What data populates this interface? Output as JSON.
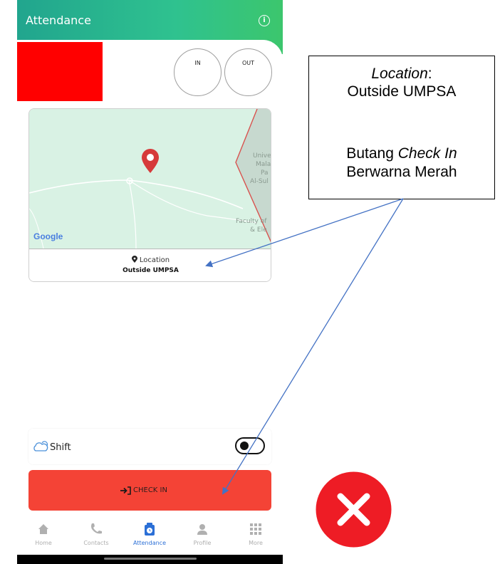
{
  "app": {
    "title": "Attendance",
    "accent_color": "#2fc28f",
    "info_icon": "info-icon"
  },
  "punch": {
    "in_label": "IN",
    "out_label": "OUT"
  },
  "map": {
    "provider_logo": "Google",
    "marker_color": "#d63a3a",
    "labels": [
      "Unive",
      "Mala",
      "Pa",
      "Al-Sul",
      "Faculty of",
      "& Ele"
    ],
    "location_label": "Location",
    "location_value": "Outside UMPSA"
  },
  "shift": {
    "label": "Shift",
    "toggle_state": "off"
  },
  "checkin": {
    "label": "CHECK IN",
    "button_color": "#f44336"
  },
  "nav": {
    "items": [
      {
        "label": "Home",
        "icon": "home-icon"
      },
      {
        "label": "Contacts",
        "icon": "phone-icon"
      },
      {
        "label": "Attendance",
        "icon": "attendance-icon",
        "active": true
      },
      {
        "label": "Profile",
        "icon": "person-icon"
      },
      {
        "label": "More",
        "icon": "grid-icon"
      }
    ]
  },
  "annotation": {
    "callout_location_word": "Location",
    "callout_location_suffix": ":",
    "callout_location_value": "Outside UMPSA",
    "callout_button_prefix": "Butang ",
    "callout_button_italic": "Check In",
    "callout_button_suffix": "Berwarna Merah",
    "arrow_color": "#4472c4",
    "mark_color": "#ee1c25"
  }
}
